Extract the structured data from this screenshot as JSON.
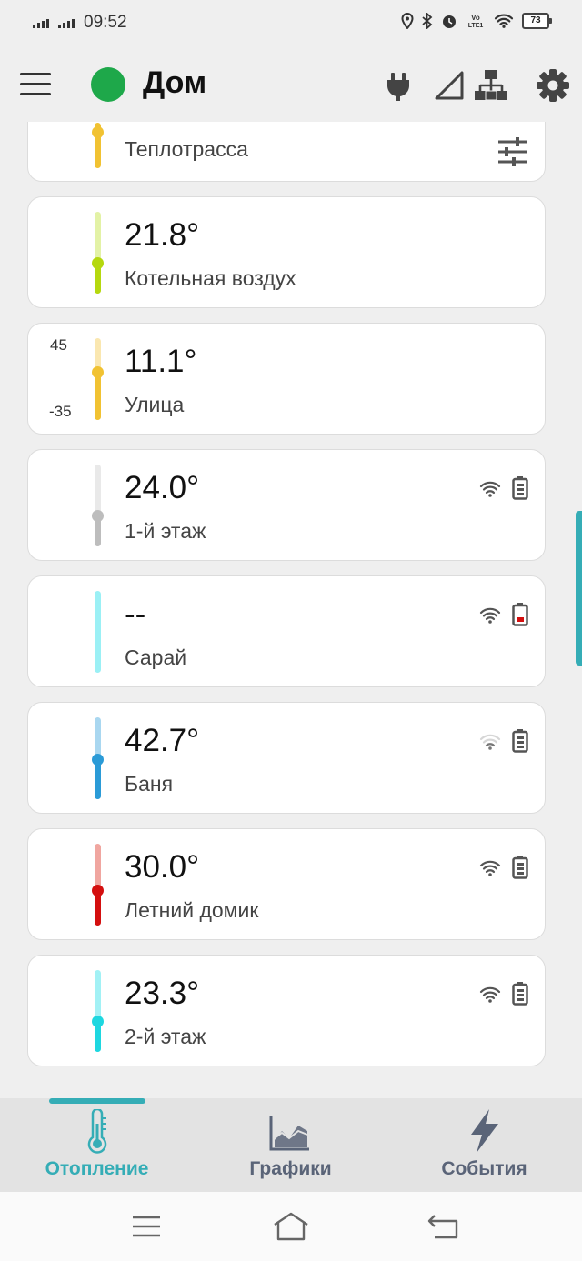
{
  "status_bar": {
    "time": "09:52",
    "battery": "73"
  },
  "app_bar": {
    "title": "Дом"
  },
  "cards": [
    {
      "label": "Теплотрасса"
    },
    {
      "value": "21.8°",
      "label": "Котельная воздух"
    },
    {
      "value": "11.1°",
      "label": "Улица",
      "range_max": "45",
      "range_min": "-35"
    },
    {
      "value": "24.0°",
      "label": "1-й этаж"
    },
    {
      "value": "--",
      "label": "Сарай"
    },
    {
      "value": "42.7°",
      "label": "Баня"
    },
    {
      "value": "30.0°",
      "label": "Летний домик"
    },
    {
      "value": "23.3°",
      "label": "2-й этаж"
    }
  ],
  "bottom_nav": {
    "items": [
      {
        "label": "Отопление",
        "icon": "thermometer-icon",
        "active": true
      },
      {
        "label": "Графики",
        "icon": "chart-icon",
        "active": false
      },
      {
        "label": "События",
        "icon": "lightning-icon",
        "active": false
      }
    ]
  },
  "colors": {
    "accent": "#35adb6",
    "online": "#1ea84a",
    "yellow": "#f1c232",
    "lime": "#b5d80f",
    "grey": "#bdbdbd",
    "light_cyan": "#9bf0f5",
    "blue": "#2b9bd7",
    "red": "#d40f0f",
    "cyan": "#1ed7e0"
  }
}
